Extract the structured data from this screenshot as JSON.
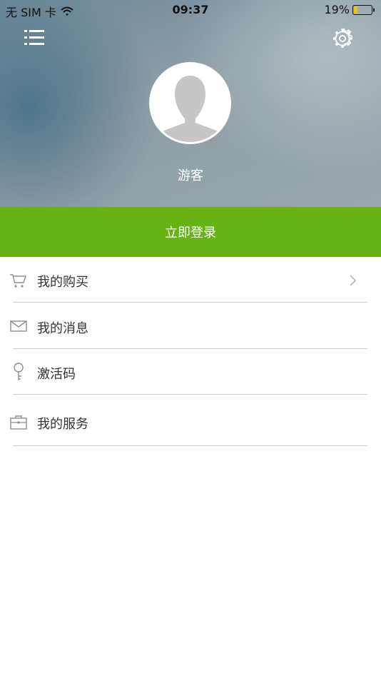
{
  "status_bar": {
    "carrier": "无 SIM 卡",
    "time": "09:37",
    "battery_percent": "19%",
    "battery_level": 0.19
  },
  "header": {
    "menu_icon": "list-icon",
    "settings_icon": "gear-icon",
    "avatar_icon": "person-silhouette-icon",
    "guest_name": "游客"
  },
  "login": {
    "label": "立即登录",
    "color": "#67b315"
  },
  "menu": {
    "items": [
      {
        "label": "我的购买",
        "icon": "cart-icon",
        "has_chevron": true
      },
      {
        "label": "我的消息",
        "icon": "mail-icon",
        "has_chevron": false
      },
      {
        "label": "激活码",
        "icon": "key-icon",
        "has_chevron": false
      },
      {
        "label": "我的服务",
        "icon": "briefcase-icon",
        "has_chevron": false
      }
    ]
  }
}
